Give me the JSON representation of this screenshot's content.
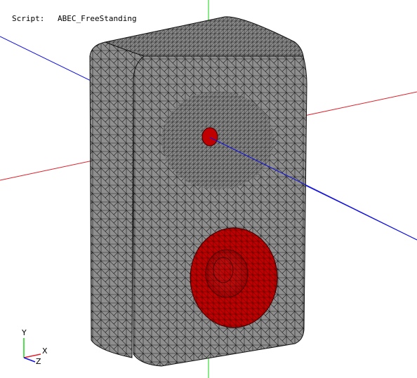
{
  "header": {
    "script_label": "Script:",
    "script_value": "ABEC_FreeStanding"
  },
  "triad": {
    "y_label": "Y",
    "x_label": "X",
    "z_label": "Z"
  },
  "colors": {
    "background": "#ffffff",
    "mesh_fill": "#8f8f8f",
    "mesh_line": "#1a1a1a",
    "driver_fill": "#c00000",
    "axis_x": "#e0202a",
    "axis_y": "#14d414",
    "axis_z": "#1010e0"
  },
  "icons": {
    "orientation_triad": "xyz-axes-icon"
  }
}
